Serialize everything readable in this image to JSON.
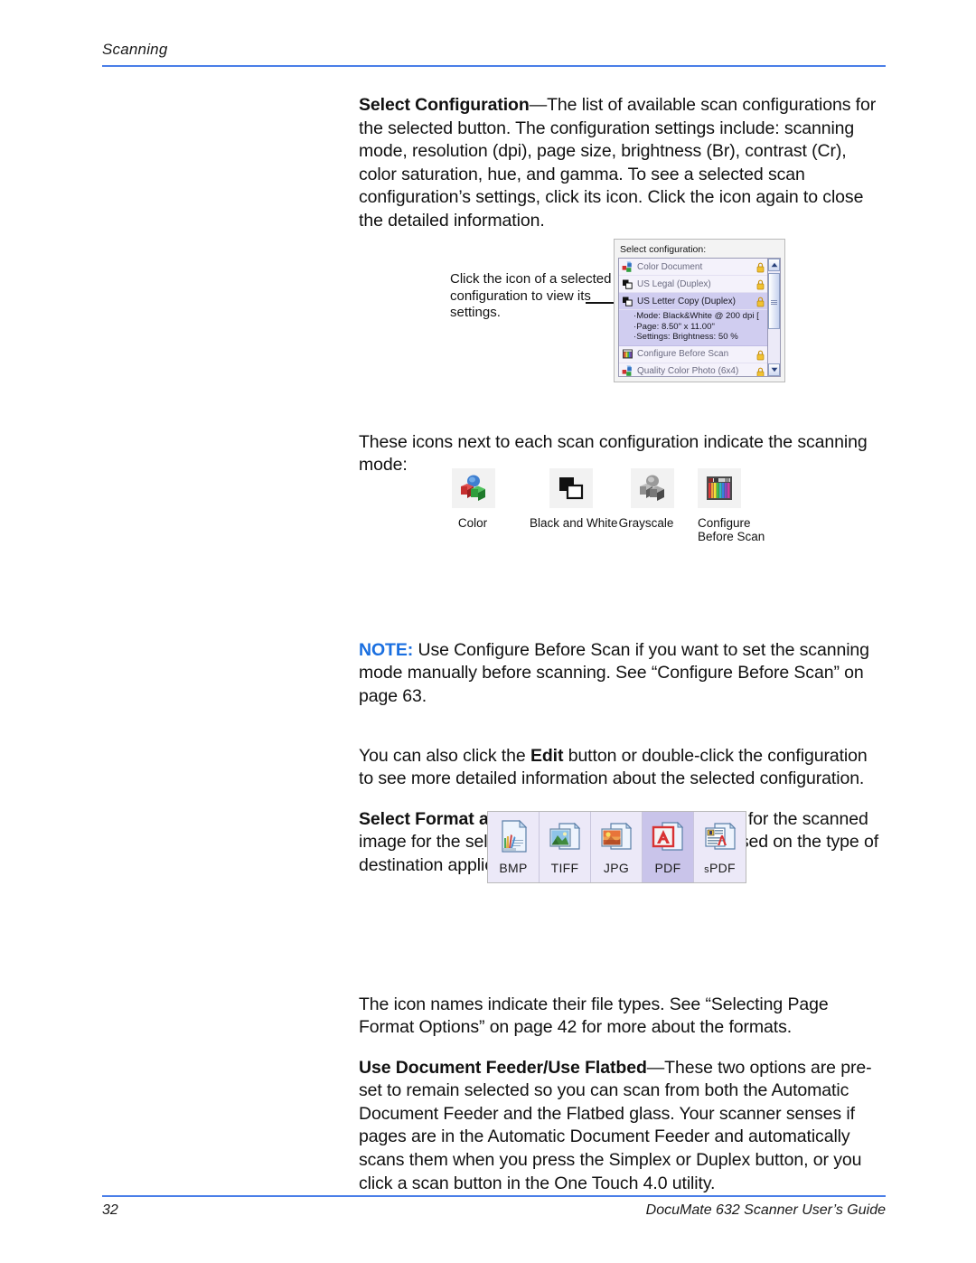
{
  "header": {
    "title": "Scanning"
  },
  "content": {
    "para_select_config_bold": "Select Configuration",
    "para_select_config": "—The list of available scan configurations for the selected button. The configuration settings include: scanning mode, resolution (dpi), page size, brightness (Br), contrast (Cr), color saturation, hue, and gamma. To see a selected scan configuration’s settings, click its icon. Click the icon again to close the detailed information.",
    "callout": "Click the icon of a selected configuration to view its settings.",
    "para_icons_intro": "These icons next to each scan configuration indicate the scanning mode:",
    "note_label": "NOTE:",
    "note_text": " Use Configure Before Scan if you want to set the scanning mode manually before scanning. See “Configure Before Scan” on page 63.",
    "para_edit_pre": "You can also click the ",
    "para_edit_bold": "Edit",
    "para_edit_post": " button or double-click the configuration to see more detailed information about the selected configuration.",
    "para_format_bold": "Select Format and Page(s)",
    "para_format": "—A set of file formats for the scanned image for the selected button. The formats are based on the type of destination application you select.",
    "para_filetypes": "The icon names indicate their file types. See “Selecting Page Format Options” on page 42 for more about the formats.",
    "para_feeder_bold": "Use Document Feeder",
    "para_feeder_sep": "/",
    "para_feeder_bold2": "Use Flatbed",
    "para_feeder": "—These two options are pre-set to remain selected so you can scan from both the Automatic Document Feeder and the Flatbed glass. Your scanner senses if pages are in the Automatic Document Feeder and automatically scans them when you press the Simplex or Duplex button, or you click a scan button in the One Touch 4.0 utility."
  },
  "config_panel": {
    "label": "Select configuration:",
    "rows": [
      {
        "name": "Color Document",
        "icon": "color-cubes-icon",
        "locked": true,
        "selected": false
      },
      {
        "name": "US Legal (Duplex)",
        "icon": "black-and-white-icon",
        "locked": true,
        "selected": false
      },
      {
        "name": "US Letter Copy (Duplex)",
        "icon": "black-and-white-icon",
        "locked": true,
        "selected": true
      },
      {
        "name": "Configure Before Scan",
        "icon": "configure-before-scan-icon",
        "locked": true,
        "selected": false
      },
      {
        "name": "Quality Color Photo (6x4)",
        "icon": "color-cubes-icon",
        "locked": true,
        "selected": false
      }
    ],
    "detail": [
      "Mode: Black&White @ 200 dpi [",
      "Page:  8.50\" x 11.00\"",
      "Settings: Brightness: 50 %"
    ],
    "scroll_up_icon": "chevron-up-icon",
    "scroll_down_icon": "chevron-down-icon"
  },
  "scan_modes": [
    {
      "label": "Color",
      "icon": "color-cubes-icon"
    },
    {
      "label": "Black and White",
      "icon": "black-and-white-icon"
    },
    {
      "label": "Grayscale",
      "icon": "grayscale-cubes-icon"
    },
    {
      "label": "Configure\nBefore Scan",
      "label_line1": "Configure",
      "label_line2": "Before Scan",
      "icon": "configure-before-scan-icon"
    }
  ],
  "formats": [
    {
      "label": "BMP",
      "icon": "bmp-file-icon",
      "selected": false
    },
    {
      "label": "TIFF",
      "icon": "tiff-file-icon",
      "selected": false
    },
    {
      "label": "JPG",
      "icon": "jpg-file-icon",
      "selected": false
    },
    {
      "label": "PDF",
      "icon": "pdf-file-icon",
      "selected": true
    },
    {
      "label": "sPDF",
      "icon": "spdf-file-icon",
      "selected": false,
      "label_prefix": "s",
      "label_rest": "PDF"
    }
  ],
  "footer": {
    "page_number": "32",
    "guide_title": "DocuMate 632 Scanner User’s Guide"
  },
  "colors": {
    "rule": "#4a7ee8",
    "note": "#1a6fe0",
    "selection": "#d0cdf0",
    "format_selected": "#c9c4ea",
    "format_bg": "#ece9f8"
  }
}
